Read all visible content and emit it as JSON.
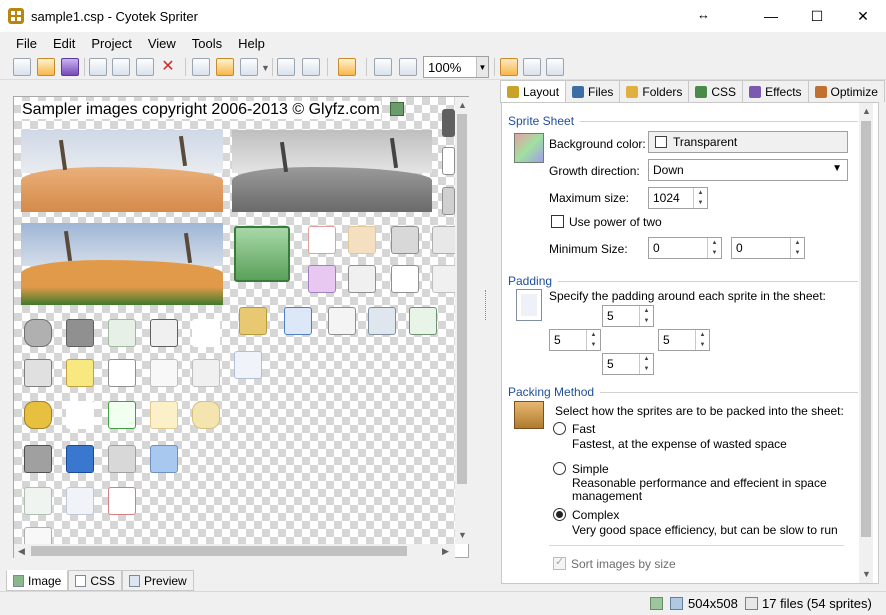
{
  "window": {
    "title": "sample1.csp - Cyotek Spriter",
    "resize_glyph": "↔",
    "minimize": "—",
    "maximize": "☐",
    "close": "✕"
  },
  "menu": [
    "File",
    "Edit",
    "Project",
    "View",
    "Tools",
    "Help"
  ],
  "toolbar": {
    "zoom_value": "100%",
    "zoom_arrow": "▼",
    "buttons": [
      "new-icon",
      "open-icon",
      "save-icon",
      "cut-icon",
      "copy-icon",
      "paste-icon",
      "delete-icon",
      "add-image-icon",
      "add-folder-icon",
      "add-dropdown-icon",
      "import-icon",
      "export-icon",
      "generate-sheet-icon",
      "zoom-in-icon",
      "zoom-out-icon",
      "grid-icon",
      "sprite-label-icon",
      "preview-icon"
    ]
  },
  "canvas": {
    "copyright": "Sampler images copyright 2006-2013 © Glyfz.com"
  },
  "bottom_tabs": [
    {
      "label": "Image"
    },
    {
      "label": "CSS"
    },
    {
      "label": "Preview"
    }
  ],
  "right_tabs": [
    {
      "label": "Layout",
      "color": "#c9a227"
    },
    {
      "label": "Files",
      "color": "#3a6ea5"
    },
    {
      "label": "Folders",
      "color": "#e0b040"
    },
    {
      "label": "CSS",
      "color": "#4a8a4a"
    },
    {
      "label": "Effects",
      "color": "#7a5ab0"
    },
    {
      "label": "Optimize",
      "color": "#c07030"
    }
  ],
  "layout": {
    "sprite_sheet": {
      "heading": "Sprite Sheet",
      "background_color_label": "Background color:",
      "background_color_value": "Transparent",
      "growth_direction_label": "Growth direction:",
      "growth_direction_value": "Down",
      "maximum_size_label": "Maximum size:",
      "maximum_size_value": "1024",
      "use_power_of_two_label": "Use power of two",
      "minimum_size_label": "Minimum Size:",
      "minimum_width": "0",
      "minimum_height": "0"
    },
    "padding": {
      "heading": "Padding",
      "description": "Specify the padding around each sprite in the sheet:",
      "top": "5",
      "left": "5",
      "right": "5",
      "bottom": "5"
    },
    "packing": {
      "heading": "Packing Method",
      "description": "Select how the sprites are to be packed into the sheet:",
      "options": [
        {
          "label": "Fast",
          "detail": "Fastest, at the expense of wasted space",
          "checked": false
        },
        {
          "label": "Simple",
          "detail": "Reasonable performance and effecient in space management",
          "checked": false
        },
        {
          "label": "Complex",
          "detail": "Very good space efficiency, but can be slow to run",
          "checked": true
        }
      ],
      "sort_images_label": "Sort images by size"
    }
  },
  "status": {
    "dimensions": "504x508",
    "files": "17 files (54 sprites)"
  },
  "colors": {
    "accent": "#1f4e9a",
    "selected_tool": "#f7b64a"
  }
}
